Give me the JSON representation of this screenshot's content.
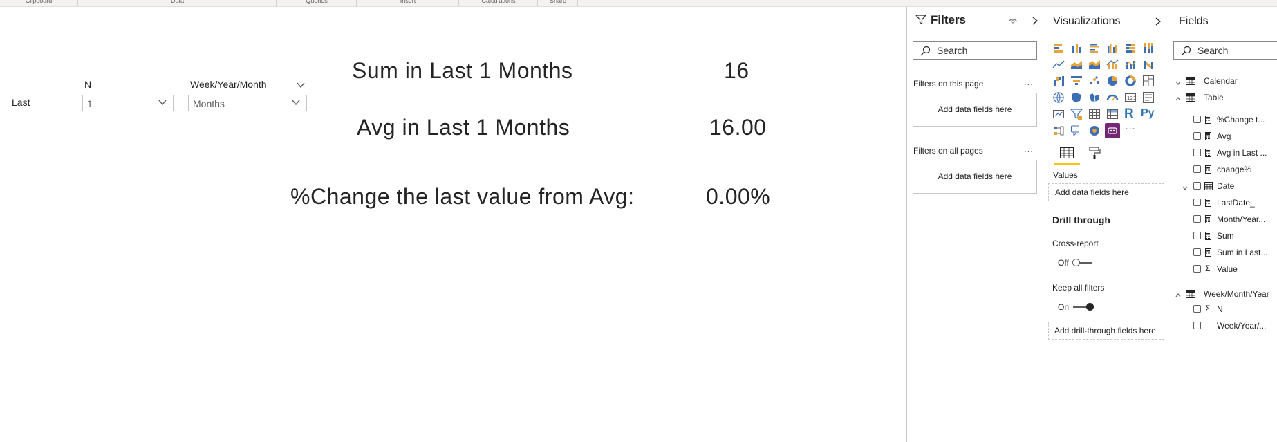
{
  "ribbon": {
    "groups": [
      "Clipboard",
      "Data",
      "Queries",
      "Insert",
      "Calculations",
      "Share"
    ]
  },
  "report": {
    "slicer_row_label": "Last",
    "slicer_n": {
      "header": "N",
      "value": "1"
    },
    "slicer_period": {
      "header": "Week/Year/Month",
      "value": "Months"
    },
    "cards": [
      {
        "label": "Sum in Last 1 Months",
        "value": "16"
      },
      {
        "label": "Avg in Last 1 Months",
        "value": "16.00"
      },
      {
        "label": "%Change the last value from Avg:",
        "value": "0.00%"
      }
    ]
  },
  "filters": {
    "title": "Filters",
    "search_placeholder": "Search",
    "on_this_page_label": "Filters on this page",
    "on_this_page_well": "Add data fields here",
    "on_all_pages_label": "Filters on all pages",
    "on_all_pages_well": "Add data fields here",
    "more": "..."
  },
  "visualizations": {
    "title": "Visualizations",
    "values_label": "Values",
    "values_well": "Add data fields here",
    "drill_through_title": "Drill through",
    "cross_report_label": "Cross-report",
    "cross_report_state": "Off",
    "keep_filters_label": "Keep all filters",
    "keep_filters_state": "On",
    "drill_well": "Add drill-through fields here",
    "r_label": "R",
    "py_label": "Py",
    "more": "···",
    "accent_color": "#f2c811",
    "selected_icon_color": "#742774"
  },
  "fields": {
    "title": "Fields",
    "search_placeholder": "Search",
    "tables": [
      {
        "name": "Calendar",
        "expanded": false,
        "items": []
      },
      {
        "name": "Table",
        "expanded": true,
        "items": [
          {
            "name": "%Change t...",
            "kind": "measure"
          },
          {
            "name": "Avg",
            "kind": "measure"
          },
          {
            "name": "Avg in Last ...",
            "kind": "measure"
          },
          {
            "name": "change%",
            "kind": "measure"
          },
          {
            "name": "Date",
            "kind": "date-hierarchy"
          },
          {
            "name": "LastDate_",
            "kind": "measure"
          },
          {
            "name": "Month/Year...",
            "kind": "measure"
          },
          {
            "name": "Sum",
            "kind": "measure"
          },
          {
            "name": "Sum in Last...",
            "kind": "measure"
          },
          {
            "name": "Value",
            "kind": "sum"
          }
        ]
      },
      {
        "name": "Week/Month/Year",
        "expanded": true,
        "items": [
          {
            "name": "N",
            "kind": "sum"
          },
          {
            "name": "Week/Year/...",
            "kind": "column"
          }
        ]
      }
    ]
  }
}
